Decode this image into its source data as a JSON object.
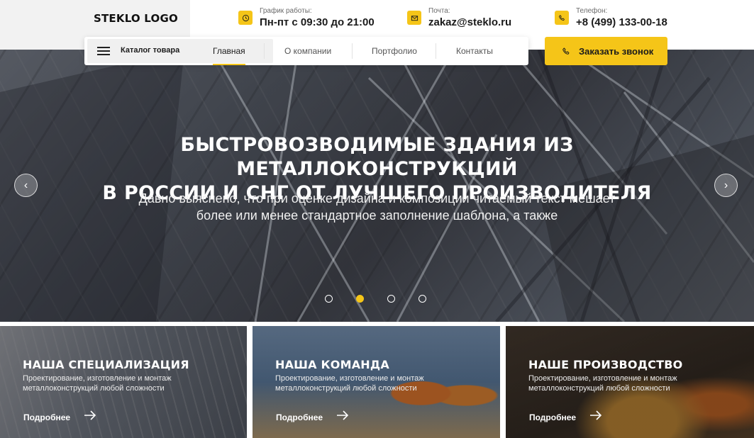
{
  "header": {
    "logo": "STEKLO LOGO",
    "hours": {
      "label": "График работы:",
      "value": "Пн-пт с 09:30 до 21:00",
      "icon": "clock-icon"
    },
    "mail": {
      "label": "Почта:",
      "value": "zakaz@steklo.ru",
      "icon": "mail-icon"
    },
    "phone": {
      "label": "Телефон:",
      "value": "+8 (499) 133-00-18",
      "icon": "phone-icon"
    }
  },
  "nav": {
    "catalog_label": "Каталог товара",
    "items": [
      {
        "label": "Главная",
        "active": true
      },
      {
        "label": "О компании",
        "active": false
      },
      {
        "label": "Портфолио",
        "active": false
      },
      {
        "label": "Контакты",
        "active": false
      }
    ],
    "call_button": "Заказать звонок"
  },
  "hero": {
    "title_line1": "БЫСТРОВОЗВОДИМЫЕ ЗДАНИЯ ИЗ МЕТАЛЛОКОНСТРУКЦИЙ",
    "title_line2": "В РОССИИ И СНГ ОТ ЛУЧШЕГО ПРОИЗВОДИТЕЛЯ",
    "subtitle_line1": "Давно выяснено, что при оценке дизайна и композиции читаемый текст мешает",
    "subtitle_line2": "более или менее стандартное заполнение шаблона, а также",
    "prev_icon": "‹",
    "next_icon": "›",
    "slides_count": 4,
    "active_slide": 2
  },
  "cards": [
    {
      "title": "НАША СПЕЦИАЛИЗАЦИЯ",
      "text": "Проектирование, изготовление и монтаж металлоконструкций любой сложности",
      "more": "Подробнее"
    },
    {
      "title": "НАША КОМАНДА",
      "text": "Проектирование, изготовление и монтаж металлоконструкций любой сложности",
      "more": "Подробнее"
    },
    {
      "title": "НАШЕ ПРОИЗВОДСТВО",
      "text": "Проектирование, изготовление и монтаж металлоконструкций любой сложности",
      "more": "Подробнее"
    }
  ],
  "colors": {
    "accent": "#f5c518",
    "text": "#1b1b1b"
  }
}
